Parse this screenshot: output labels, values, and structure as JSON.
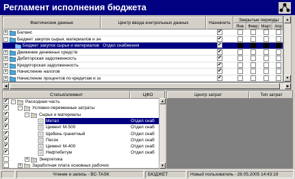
{
  "window": {
    "title": "Регламент исполнения бюджета"
  },
  "top_grid": {
    "columns": {
      "fact": "Фактические данные",
      "center": "Центр ввода контрольных данных",
      "assign": "Назначить",
      "closed": "Закрытые периоды",
      "periods": [
        "Янв",
        "Февр",
        "Март",
        "Апр"
      ]
    },
    "rows": [
      {
        "label": "Баланс",
        "center": "",
        "assign": true,
        "level": 0,
        "expander": "+",
        "selected": false
      },
      {
        "label": "Бюджет закупок сырья, материалов и энергоресурсов",
        "center": "",
        "assign": true,
        "level": 0,
        "expander": "-",
        "selected": false
      },
      {
        "label": "Бюджет закупок сырья и материалов",
        "center": "Отдел снабжения",
        "assign": true,
        "level": 1,
        "expander": "",
        "selected": true
      },
      {
        "label": "Движение денежных средств",
        "center": "",
        "assign": true,
        "level": 0,
        "expander": "+",
        "selected": false
      },
      {
        "label": "Дебиторская задолженность",
        "center": "",
        "assign": true,
        "level": 0,
        "expander": "+",
        "selected": false
      },
      {
        "label": "Кредиторская задолженность",
        "center": "",
        "assign": true,
        "level": 0,
        "expander": "+",
        "selected": false
      },
      {
        "label": "Начисление налогов",
        "center": "",
        "assign": true,
        "level": 0,
        "expander": "+",
        "selected": false
      },
      {
        "label": "Начисление процентов по кредитам и займам",
        "center": "",
        "assign": true,
        "level": 0,
        "expander": "+",
        "selected": false
      }
    ]
  },
  "left_grid": {
    "columns": {
      "article": "Статья/элемент",
      "cfo": "ЦФО"
    },
    "rows": [
      {
        "label": "Расходная часть",
        "cfo": "",
        "level": 0,
        "expander": "-",
        "checked": true,
        "selected": false
      },
      {
        "label": "Условно-переменные затраты",
        "cfo": "",
        "level": 1,
        "expander": "-",
        "checked": true,
        "selected": false
      },
      {
        "label": "Сырье и материалы",
        "cfo": "",
        "level": 2,
        "expander": "-",
        "checked": true,
        "selected": false
      },
      {
        "label": "Метал",
        "cfo": "Отдел снаб",
        "level": 3,
        "expander": "",
        "checked": true,
        "selected": true
      },
      {
        "label": "Цемент М-500",
        "cfo": "Отдел снаб",
        "level": 3,
        "expander": "",
        "checked": true,
        "selected": false
      },
      {
        "label": "Щебень гранитный",
        "cfo": "Отдел снаб",
        "level": 3,
        "expander": "",
        "checked": true,
        "selected": false
      },
      {
        "label": "Песок",
        "cfo": "Отдел снаб",
        "level": 3,
        "expander": "",
        "checked": true,
        "selected": false
      },
      {
        "label": "Цемент М-400",
        "cfo": "Отдел снаб",
        "level": 3,
        "expander": "",
        "checked": true,
        "selected": false
      },
      {
        "label": "Нефтебитум",
        "cfo": "Отдел снаб",
        "level": 3,
        "expander": "",
        "checked": true,
        "selected": false
      },
      {
        "label": "Энергетика",
        "cfo": "",
        "level": 2,
        "expander": "+",
        "checked": false,
        "selected": false
      },
      {
        "label": "Заработная плата основных рабочих",
        "cfo": "",
        "level": 1,
        "expander": "+",
        "checked": false,
        "selected": false
      }
    ]
  },
  "right_grid": {
    "columns": {
      "cost_center": "Центр затрат",
      "cost_type": "Тип затрат"
    }
  },
  "status": {
    "mode": "Чтение и запись - BC-TASK",
    "module": "БЮДЖЕТ",
    "user": "Новый пользователь - 28.05.2005 14:43:19"
  },
  "colors": {
    "titlebar": "#000080",
    "selection": "#000080",
    "face": "#d4d0c8"
  }
}
